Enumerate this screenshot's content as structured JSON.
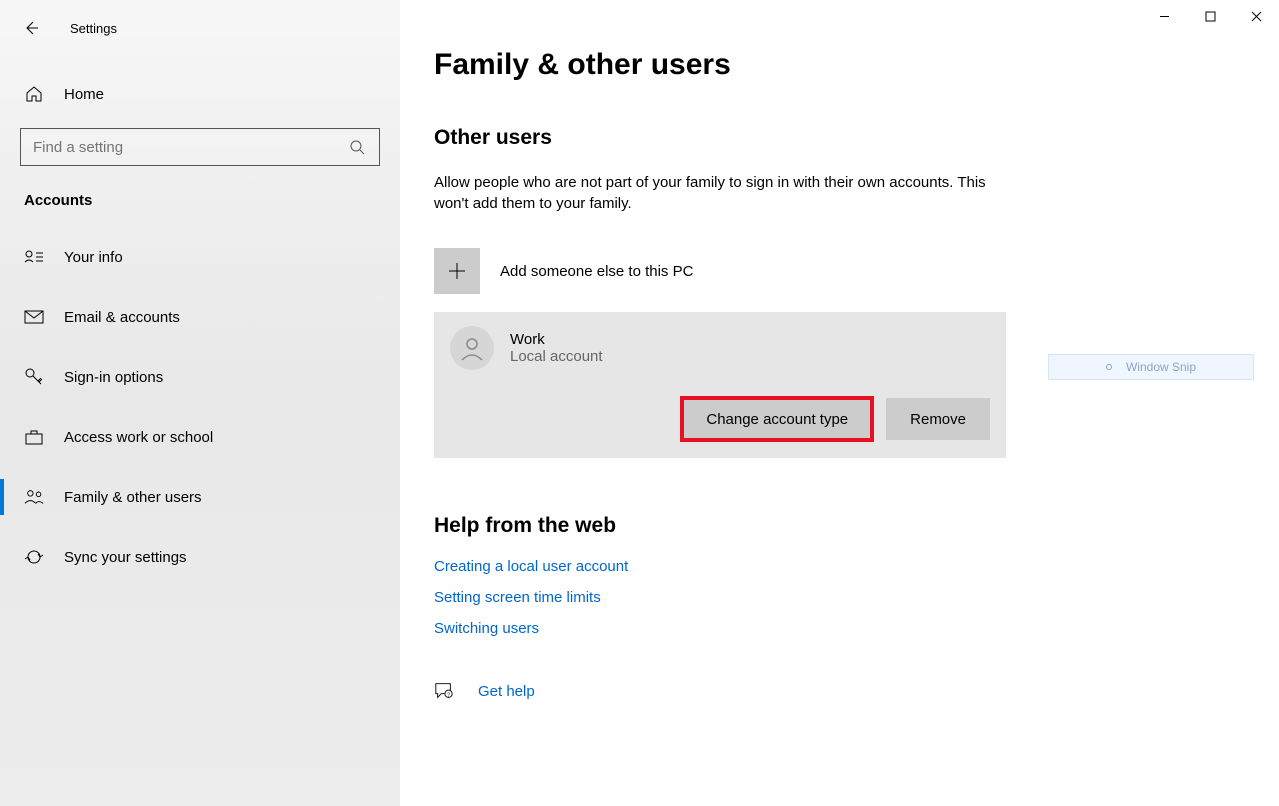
{
  "app_title": "Settings",
  "sidebar": {
    "home": "Home",
    "search_placeholder": "Find a setting",
    "section": "Accounts",
    "items": [
      {
        "label": "Your info"
      },
      {
        "label": "Email & accounts"
      },
      {
        "label": "Sign-in options"
      },
      {
        "label": "Access work or school"
      },
      {
        "label": "Family & other users"
      },
      {
        "label": "Sync your settings"
      }
    ]
  },
  "main": {
    "title": "Family & other users",
    "other_users_heading": "Other users",
    "other_users_desc": "Allow people who are not part of your family to sign in with their own accounts. This won't add them to your family.",
    "add_label": "Add someone else to this PC",
    "user": {
      "name": "Work",
      "type": "Local account",
      "change_btn": "Change account type",
      "remove_btn": "Remove"
    },
    "help_heading": "Help from the web",
    "help_links": [
      "Creating a local user account",
      "Setting screen time limits",
      "Switching users"
    ],
    "get_help": "Get help",
    "snip_label": "Window Snip"
  }
}
